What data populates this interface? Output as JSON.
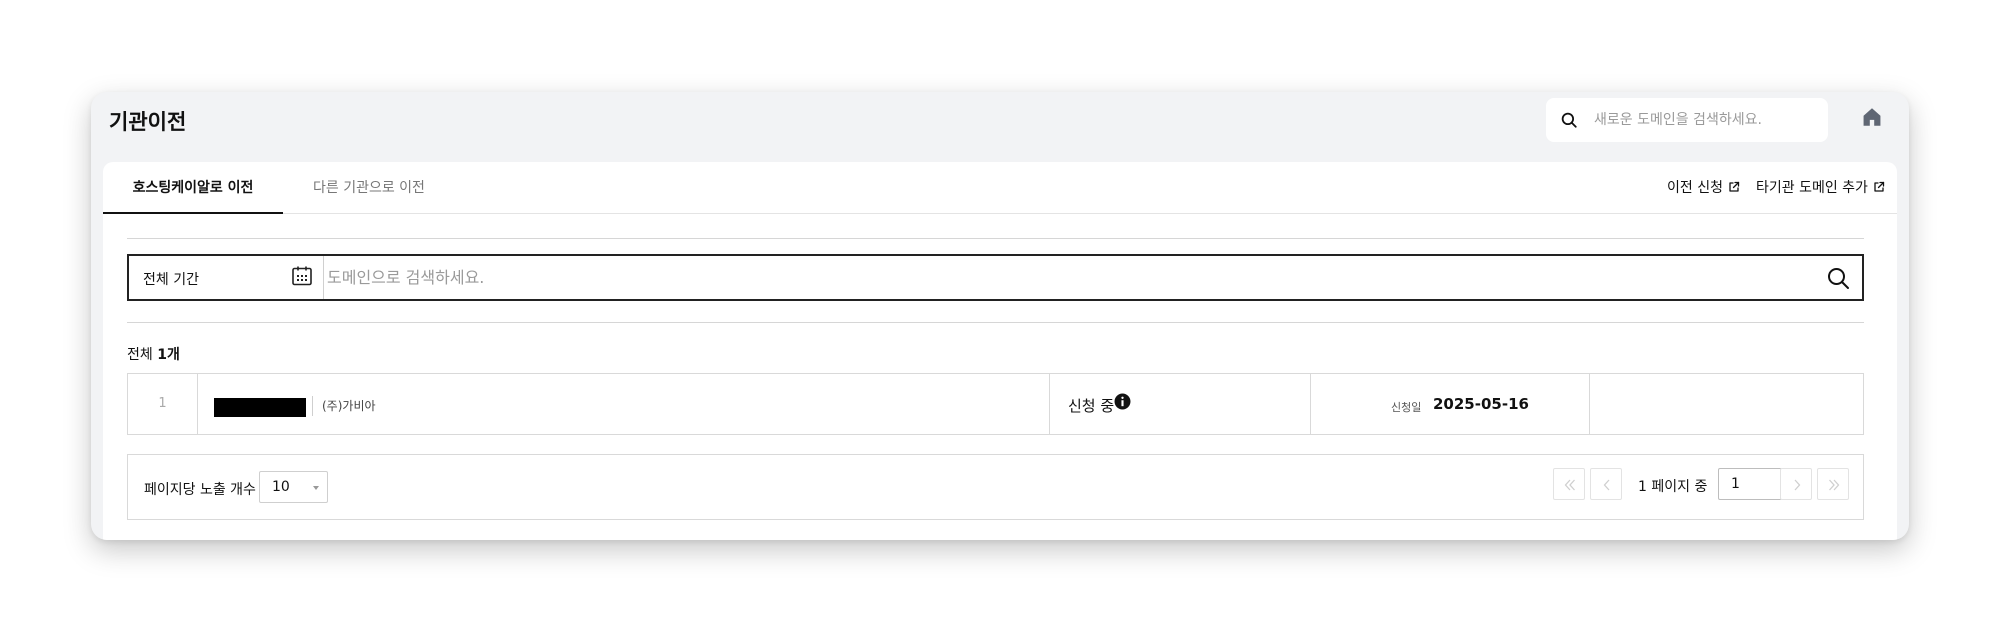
{
  "header": {
    "title": "기관이전",
    "search_placeholder": "새로운 도메인을 검색하세요."
  },
  "tabs": [
    {
      "label": "호스팅케이알로 이전",
      "active": true
    },
    {
      "label": "다른 기관으로 이전",
      "active": false
    }
  ],
  "links": {
    "transfer_request": "이전 신청",
    "add_other_domain": "타기관 도메인 추가"
  },
  "filter": {
    "period_label": "전체 기간",
    "search_placeholder": "도메인으로 검색하세요."
  },
  "summary": {
    "prefix": "전체",
    "count": "1개"
  },
  "results": [
    {
      "index": "1",
      "company": "(주)가비아",
      "status": "신청 중",
      "date_label": "신청일",
      "date": "2025-05-16"
    }
  ],
  "pagination": {
    "per_page_label": "페이지당 노출 개수",
    "per_page_value": "10",
    "page_status": "1 페이지 중",
    "current_page": "1"
  },
  "icons": {
    "top_search": "search-icon",
    "home": "home-icon",
    "external": "external-link-icon",
    "calendar": "calendar-icon",
    "search": "search-icon",
    "info": "info-icon"
  },
  "colors": {
    "header_bg": "#f2f3f5",
    "border_dark": "#222222",
    "muted_text": "#777777"
  }
}
